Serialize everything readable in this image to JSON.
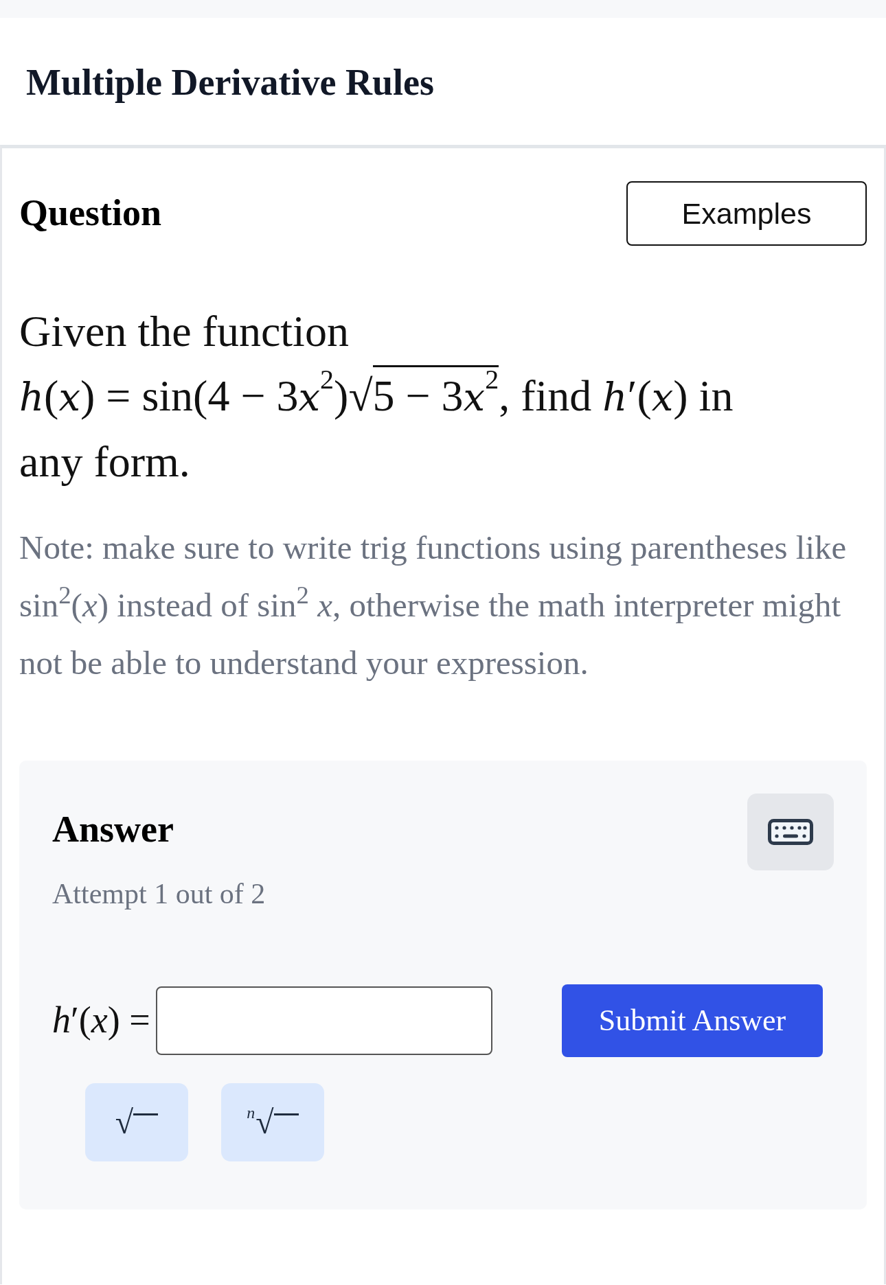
{
  "page_title": "Multiple Derivative Rules",
  "question": {
    "heading": "Question",
    "examples_button": "Examples",
    "prompt": [
      {
        "kind": "text",
        "text": "Given the function"
      },
      {
        "kind": "math",
        "parts": [
          {
            "kind": "var",
            "text": "h"
          },
          {
            "kind": "roman",
            "text": "("
          },
          {
            "kind": "var",
            "text": "x"
          },
          {
            "kind": "roman",
            "text": ") = sin(4 − 3"
          },
          {
            "kind": "var",
            "text": "x"
          },
          {
            "kind": "sup",
            "text": "2"
          },
          {
            "kind": "roman",
            "text": ")"
          },
          {
            "kind": "sqrt",
            "sign": "√",
            "parts": [
              {
                "kind": "roman",
                "text": "5 − 3"
              },
              {
                "kind": "var",
                "text": "x"
              },
              {
                "kind": "sup",
                "text": "2"
              }
            ]
          }
        ]
      },
      {
        "kind": "text",
        "text": ", find"
      },
      {
        "kind": "math",
        "parts": [
          {
            "kind": "var",
            "text": "h"
          },
          {
            "kind": "roman",
            "text": "′("
          },
          {
            "kind": "var",
            "text": "x"
          },
          {
            "kind": "roman",
            "text": ")"
          }
        ]
      },
      {
        "kind": "text",
        "text": "in any form."
      }
    ],
    "note": "Note: make sure to write trig functions using parentheses like sin$^{2}$(*x*) instead of sin$^{2}$ *x*, otherwise the math interpreter might not be able to understand your expression."
  },
  "answer": {
    "heading": "Answer",
    "attempt": "Attempt 1 out of 2",
    "input_label": "*h*′(*x*) =",
    "submit": "Submit Answer",
    "math_buttons": [
      {
        "kind": "sqrt",
        "sign": "√"
      },
      {
        "kind": "nthroot",
        "sign": "√",
        "index": "n"
      }
    ]
  }
}
